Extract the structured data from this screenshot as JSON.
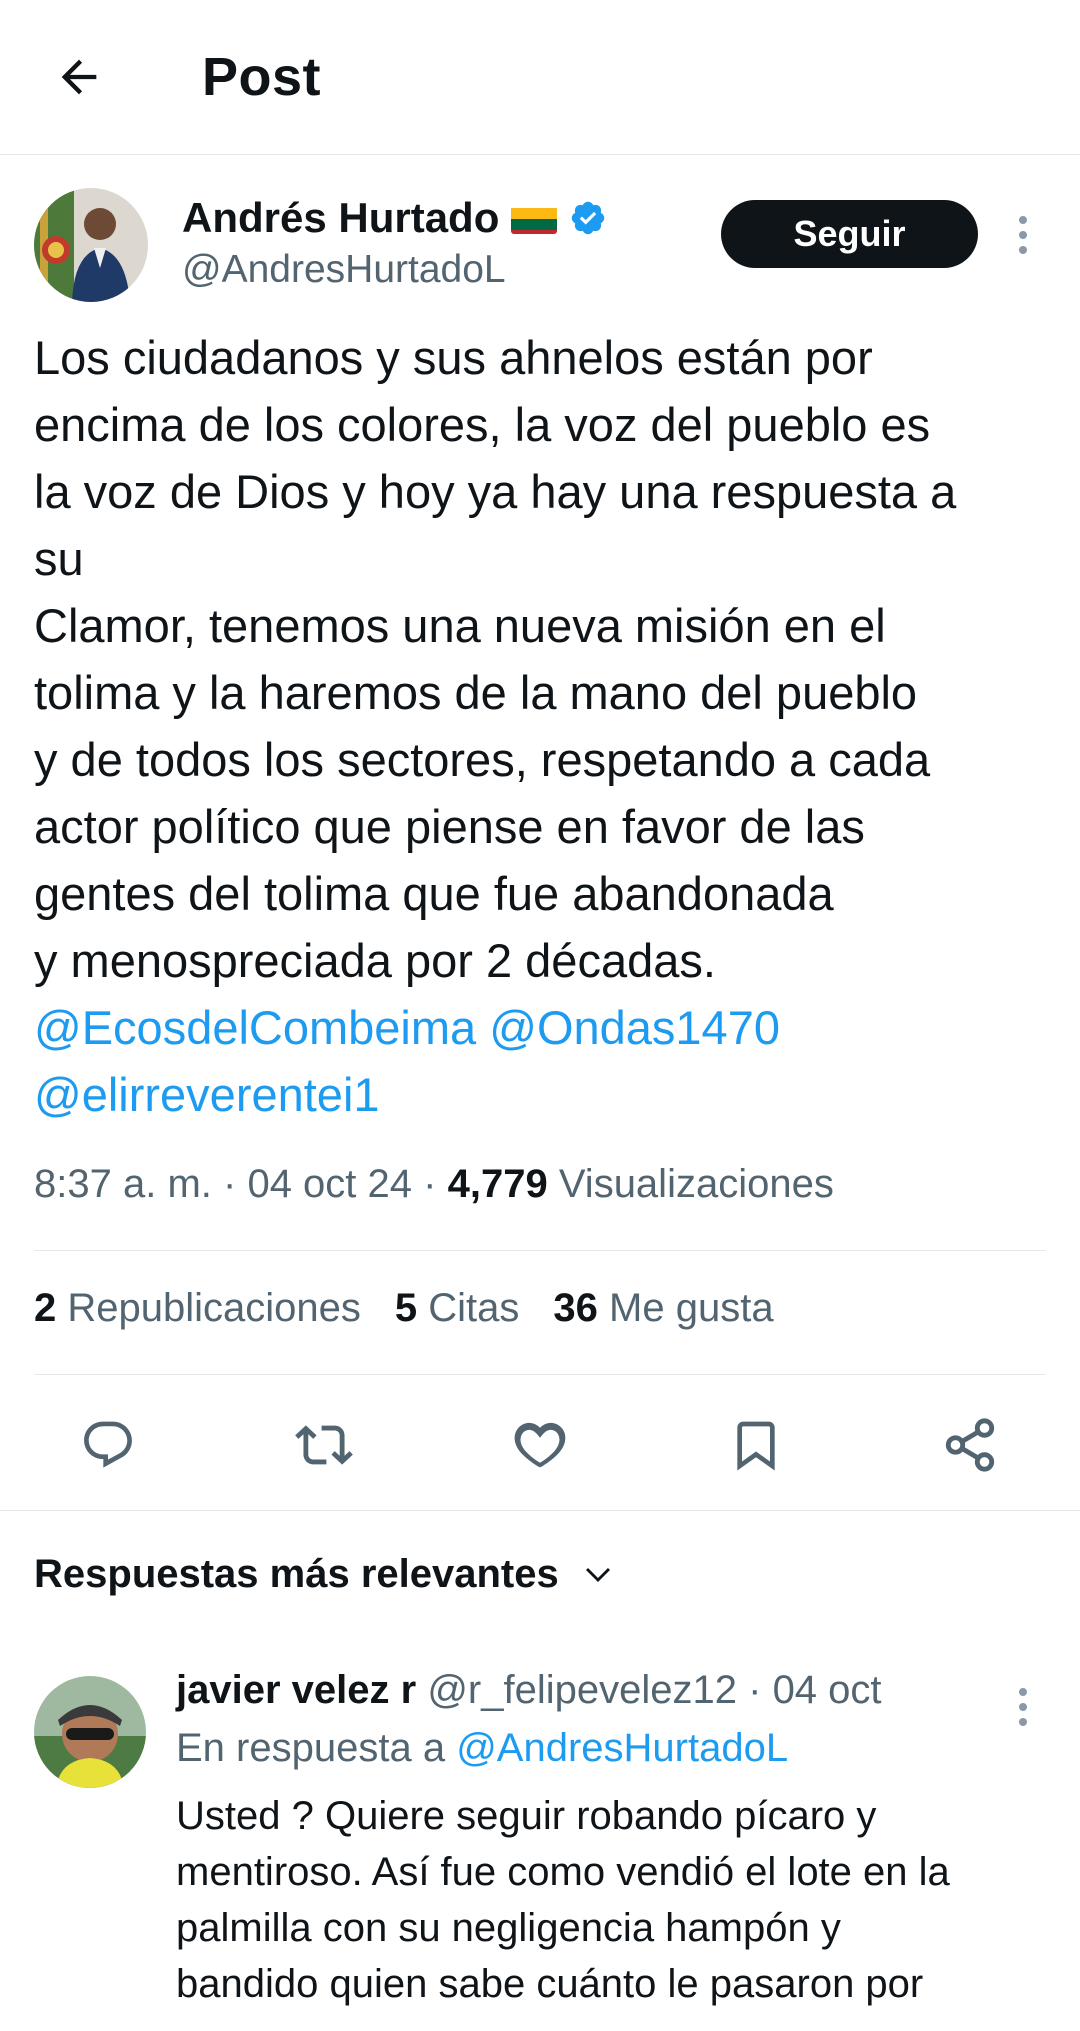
{
  "header": {
    "title": "Post"
  },
  "post": {
    "author_name": "Andrés Hurtado",
    "author_handle": "@AndresHurtadoL",
    "follow_label": "Seguir",
    "text_lines": [
      "Los ciudadanos y sus ahnelos están por",
      "encima de los colores, la voz del pueblo es",
      "la voz de Dios y hoy ya hay una respuesta a",
      "su",
      "Clamor, tenemos una nueva misión en el",
      "tolima y la haremos de la mano del pueblo",
      "y de todos los sectores, respetando a cada",
      "actor político que piense en favor de las",
      "gentes del tolima que fue abandonada",
      "y menospreciada  por 2 décadas."
    ],
    "mentions": [
      "@EcosdelCombeima",
      "@Ondas1470",
      "@elirreverentei1"
    ],
    "time": "8:37 a. m.",
    "date": "04 oct 24",
    "views_count": "4,779",
    "views_label": "Visualizaciones",
    "separator": "·"
  },
  "stats": {
    "reposts_count": "2",
    "reposts_label": "Republicaciones",
    "quotes_count": "5",
    "quotes_label": "Citas",
    "likes_count": "36",
    "likes_label": "Me gusta"
  },
  "replies": {
    "header": "Respuestas más relevantes",
    "items": [
      {
        "name": "javier velez r",
        "handle": "@r_felipevelez12",
        "date": "04 oct",
        "reply_to_prefix": "En respuesta a",
        "reply_to_handle": "@AndresHurtadoL",
        "text_lines": [
          "Usted ? Quiere seguir robando pícaro y",
          "mentiroso. Así fue como vendió el lote en la",
          "palmilla con su negligencia hampón y",
          "bandido quien sabe cuánto le pasaron por"
        ]
      }
    ]
  },
  "colors": {
    "accent": "#1d9bf0",
    "text": "#0f1419",
    "muted": "#536471",
    "border": "#e6e9ec"
  },
  "icons": [
    "back-arrow-icon",
    "verified-icon",
    "flag-icon",
    "more-icon",
    "reply-icon",
    "repost-icon",
    "like-icon",
    "bookmark-icon",
    "share-icon",
    "chevron-down-icon"
  ]
}
